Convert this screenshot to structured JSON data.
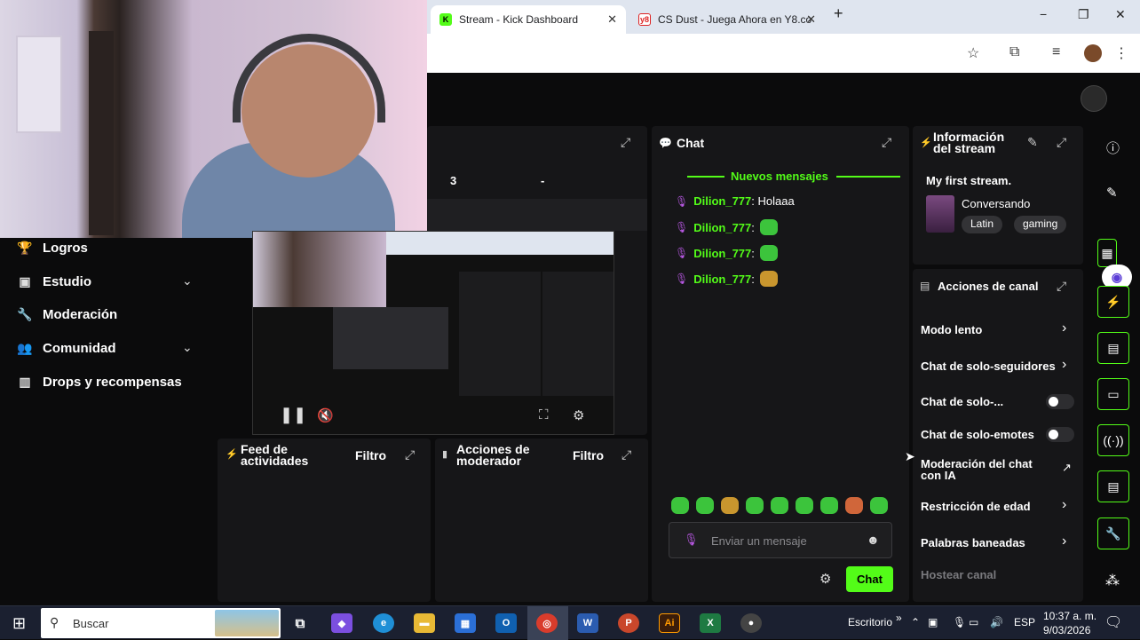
{
  "browser": {
    "tabs": [
      {
        "label": "Stream - Kick Dashboard",
        "icon": "kick-logo-icon"
      },
      {
        "label": "CS Dust - Juega Ahora en Y8.co",
        "icon": "y8-logo-icon"
      }
    ],
    "new_tab": "+",
    "win_minimize": "−",
    "win_maximize": "❐",
    "win_close": "✕"
  },
  "sidebar": {
    "items": [
      {
        "label": "Logros",
        "icon": "trophy-icon"
      },
      {
        "label": "Estudio",
        "icon": "studio-icon",
        "chevron": "⌄"
      },
      {
        "label": "Moderación",
        "icon": "wrench-icon"
      },
      {
        "label": "Comunidad",
        "icon": "community-icon",
        "chevron": "⌄"
      },
      {
        "label": "Drops y recompensas",
        "icon": "drops-icon"
      }
    ]
  },
  "stats_panel": {
    "value_a": "3",
    "value_b": "-"
  },
  "feed_panel": {
    "title_line1": "Feed de",
    "title_line2": "actividades",
    "filter": "Filtro"
  },
  "modactions_panel": {
    "title_line1": "Acciones de",
    "title_line2": "moderador",
    "filter": "Filtro"
  },
  "chat": {
    "title": "Chat",
    "new_messages": "Nuevos mensajes",
    "messages": [
      {
        "user": "Dilion_777",
        "text": ": Holaaa"
      },
      {
        "user": "Dilion_777",
        "text": ":"
      },
      {
        "user": "Dilion_777",
        "text": ":"
      },
      {
        "user": "Dilion_777",
        "text": ":"
      }
    ],
    "input_placeholder": "Enviar un mensaje",
    "send_button": "Chat"
  },
  "stream_info": {
    "title_line1": "Información",
    "title_line2": "del stream",
    "stream_title": "My first stream.",
    "category": "Conversando",
    "tags": [
      "Latin",
      "gaming"
    ]
  },
  "channel_actions": {
    "title": "Acciones de canal",
    "items": [
      {
        "label": "Modo lento",
        "control": "arrow"
      },
      {
        "label": "Chat de solo-seguidores",
        "control": "arrow"
      },
      {
        "label": "Chat de solo-...",
        "control": "toggle"
      },
      {
        "label": "Chat de solo-emotes",
        "control": "toggle"
      },
      {
        "label": "Moderación del chat con IA",
        "control": "external"
      },
      {
        "label": "Restricción de edad",
        "control": "arrow"
      },
      {
        "label": "Palabras baneadas",
        "control": "arrow"
      },
      {
        "label": "Hostear canal",
        "control": "none"
      }
    ]
  },
  "taskbar": {
    "search_placeholder": "Buscar",
    "desktop_label": "Escritorio",
    "lang": "ESP",
    "time": "10:37 a. m.",
    "date": "9/03/2026"
  },
  "colors": {
    "accent": "#53fc18",
    "background": "#0b0b0c",
    "panel": "#161618"
  }
}
